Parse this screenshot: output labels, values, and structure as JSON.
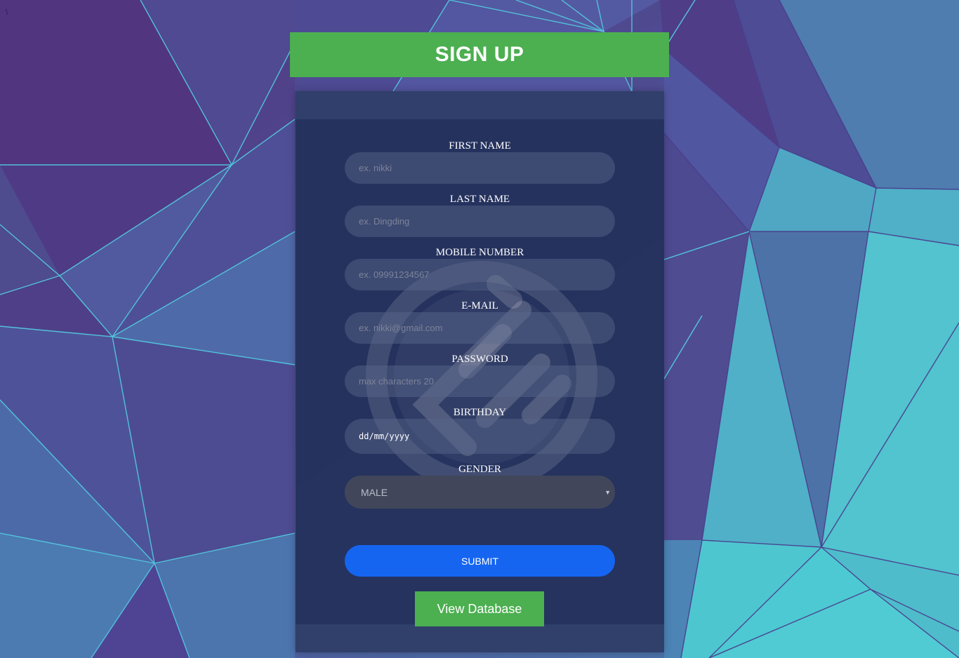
{
  "colors": {
    "header_green": "#4caf50",
    "submit_blue": "#1565f0",
    "panel": "#24325c",
    "background_purple": "#4f3a86",
    "background_teal": "#4fc6d0"
  },
  "corner_mark": "\\",
  "header": {
    "title": "SIGN UP"
  },
  "form": {
    "first_name": {
      "label": "FIRST NAME",
      "placeholder": "ex. nikki"
    },
    "last_name": {
      "label": "LAST NAME",
      "placeholder": "ex. Dingding"
    },
    "mobile": {
      "label": "MOBILE NUMBER",
      "placeholder": "ex. 09991234567"
    },
    "email": {
      "label": "E-MAIL",
      "placeholder": "ex. nikki@gmail.com"
    },
    "password": {
      "label": "PASSWORD",
      "placeholder": "max characters 20"
    },
    "birthday": {
      "label": "BIRTHDAY",
      "value": "dd/mm/yyyy"
    },
    "gender": {
      "label": "GENDER",
      "selected": "MALE"
    },
    "submit_label": "SUBMIT"
  },
  "view_database_label": "View Database",
  "icons": {
    "watermark": "logo-watermark-icon",
    "select_caret": "caret-down-icon"
  }
}
